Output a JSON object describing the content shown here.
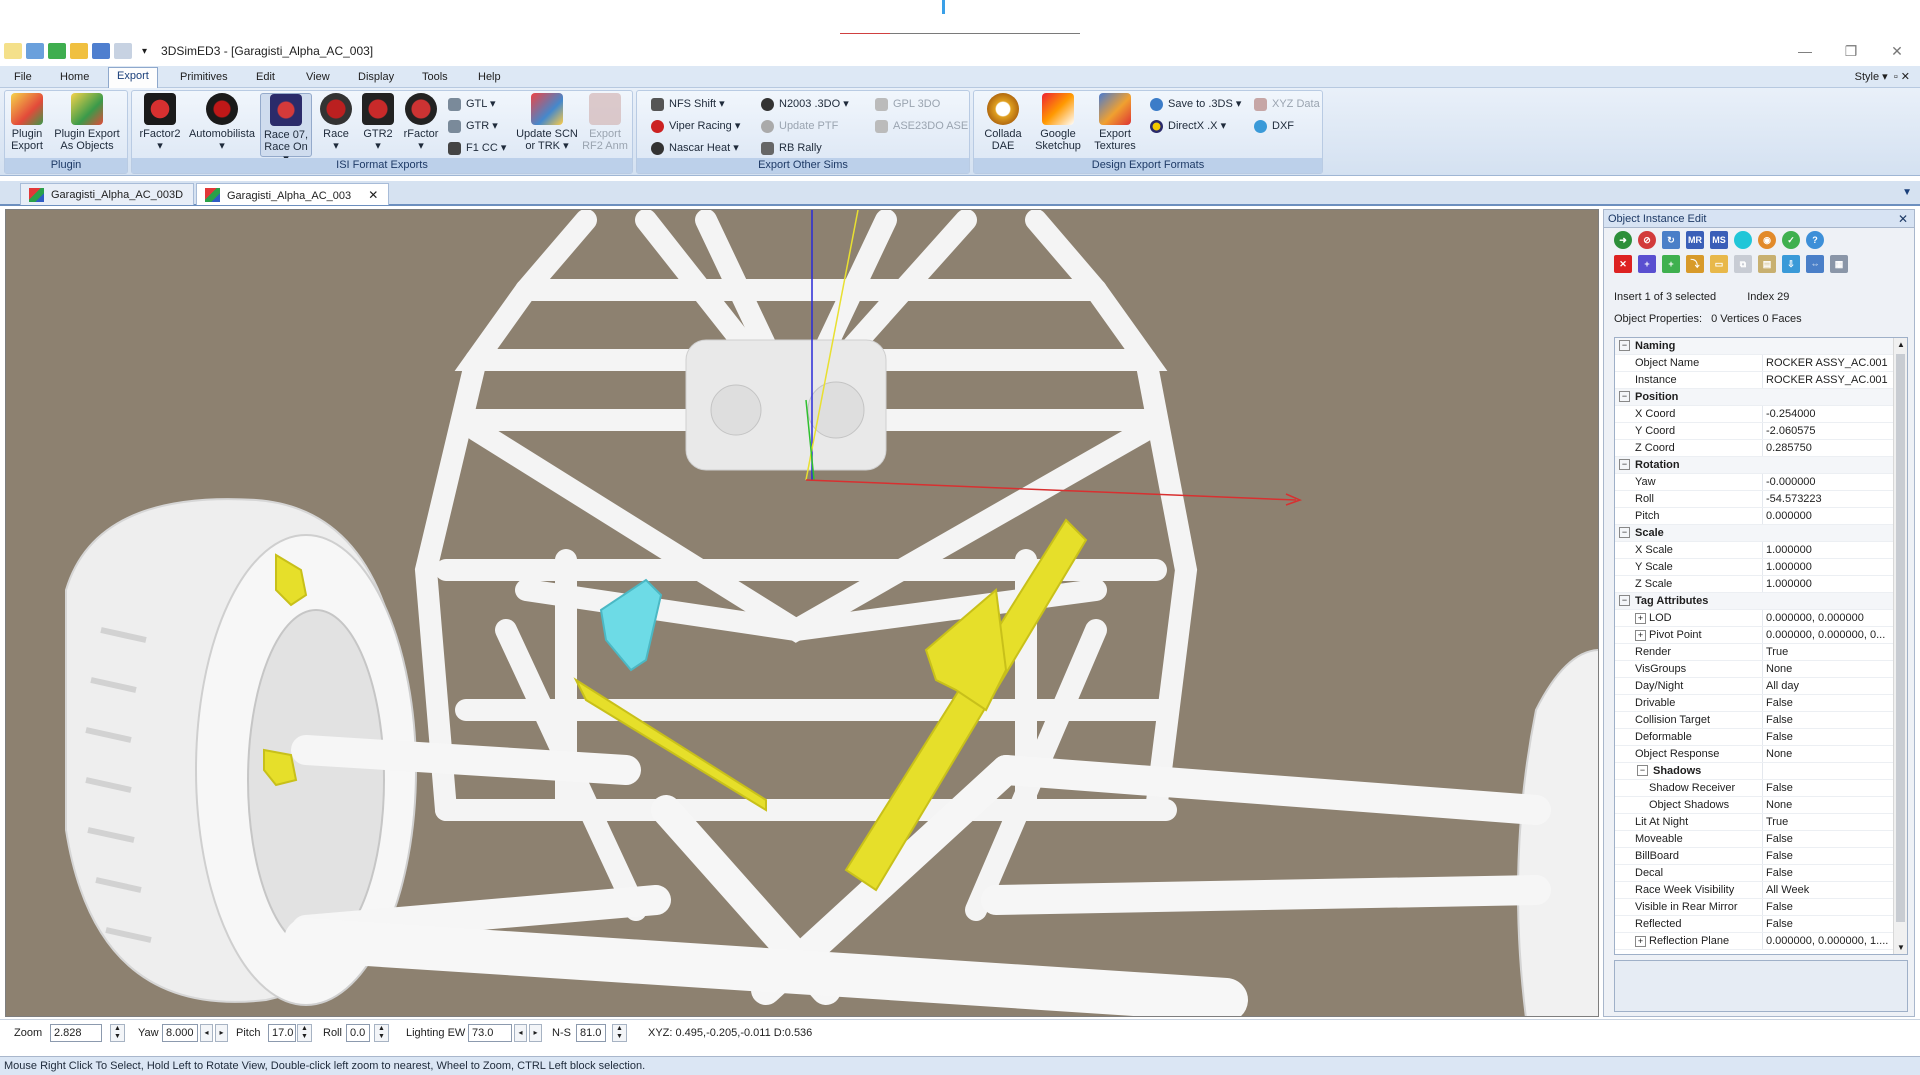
{
  "window": {
    "app_title": "3DSimED3 - [Garagisti_Alpha_AC_003]",
    "menu_arrow": "▾"
  },
  "menu": {
    "items": [
      "File",
      "Home",
      "Export",
      "Primitives",
      "Edit",
      "View",
      "Display",
      "Tools",
      "Help"
    ],
    "active": "Export",
    "style_label": "Style"
  },
  "ribbon": {
    "groups": {
      "plugin": "Plugin",
      "isi": "ISI Format Exports",
      "other": "Export Other Sims",
      "design": "Design Export Formats"
    },
    "plugin": {
      "plugin_export": [
        "Plugin",
        "Export"
      ],
      "plugin_export_objects": [
        "Plugin Export",
        "As Objects"
      ]
    },
    "isi": {
      "rfactor2": "rFactor2",
      "automobilista": "Automobilista",
      "race07": [
        "Race 07,",
        "Race On"
      ],
      "race": "Race",
      "gtr2": "GTR2",
      "rfactor": "rFactor",
      "gtl": "GTL",
      "gtr": "GTR",
      "f1cc": "F1 CC",
      "update_scn": [
        "Update SCN",
        "or TRK"
      ],
      "export_rf2_anm": [
        "Export",
        "RF2 Anm"
      ]
    },
    "other": {
      "nfs_shift": "NFS Shift",
      "viper_racing": "Viper Racing",
      "nascar_heat": "Nascar Heat",
      "n2003": "N2003 .3DO",
      "update_ptf": "Update PTF",
      "rb_rally": "RB Rally",
      "gpl_3do": "GPL 3DO",
      "ase23do": "ASE23DO ASE"
    },
    "design": {
      "collada": [
        "Collada",
        "DAE"
      ],
      "google_sketchup": [
        "Google",
        "Sketchup"
      ],
      "export_textures": [
        "Export",
        "Textures"
      ],
      "save_3ds": "Save to .3DS",
      "directx": "DirectX .X",
      "xyz_data": "XYZ Data",
      "dxf": "DXF"
    }
  },
  "tabs": [
    {
      "label": "Garagisti_Alpha_AC_003D",
      "active": false
    },
    {
      "label": "Garagisti_Alpha_AC_003",
      "active": true
    }
  ],
  "panel": {
    "title": "Object Instance Edit",
    "toolbar_text": {
      "mr": "MR",
      "ms": "MS"
    },
    "insert_info": "Insert 1 of 3 selected",
    "index_info": "Index 29",
    "object_props_label": "Object Properties:",
    "object_props_value": "0 Vertices 0 Faces",
    "rows": [
      {
        "kind": "cat",
        "name": "Naming"
      },
      {
        "kind": "prop",
        "name": "Object Name",
        "value": "ROCKER ASSY_AC.001"
      },
      {
        "kind": "prop",
        "name": "Instance",
        "value": "ROCKER ASSY_AC.001"
      },
      {
        "kind": "cat",
        "name": "Position"
      },
      {
        "kind": "prop",
        "name": "X Coord",
        "value": "-0.254000"
      },
      {
        "kind": "prop",
        "name": "Y Coord",
        "value": "-2.060575"
      },
      {
        "kind": "prop",
        "name": "Z Coord",
        "value": "0.285750"
      },
      {
        "kind": "cat",
        "name": "Rotation"
      },
      {
        "kind": "prop",
        "name": "Yaw",
        "value": "-0.000000"
      },
      {
        "kind": "prop",
        "name": "Roll",
        "value": "-54.573223"
      },
      {
        "kind": "prop",
        "name": "Pitch",
        "value": "0.000000"
      },
      {
        "kind": "cat",
        "name": "Scale"
      },
      {
        "kind": "prop",
        "name": "X Scale",
        "value": "1.000000"
      },
      {
        "kind": "prop",
        "name": "Y Scale",
        "value": "1.000000"
      },
      {
        "kind": "prop",
        "name": "Z Scale",
        "value": "1.000000"
      },
      {
        "kind": "cat",
        "name": "Tag Attributes"
      },
      {
        "kind": "expand",
        "name": "LOD",
        "value": "0.000000, 0.000000"
      },
      {
        "kind": "expand",
        "name": "Pivot Point",
        "value": "0.000000, 0.000000, 0..."
      },
      {
        "kind": "prop",
        "name": "Render",
        "value": "True"
      },
      {
        "kind": "prop",
        "name": "VisGroups",
        "value": "None"
      },
      {
        "kind": "prop",
        "name": "Day/Night",
        "value": "All day"
      },
      {
        "kind": "prop",
        "name": "Drivable",
        "value": "False"
      },
      {
        "kind": "prop",
        "name": "Collision Target",
        "value": "False"
      },
      {
        "kind": "prop",
        "name": "Deformable",
        "value": "False"
      },
      {
        "kind": "prop",
        "name": "Object Response",
        "value": "None"
      },
      {
        "kind": "subcat",
        "name": "Shadows"
      },
      {
        "kind": "sub",
        "name": "Shadow Receiver",
        "value": "False"
      },
      {
        "kind": "sub",
        "name": "Object Shadows",
        "value": "None"
      },
      {
        "kind": "prop",
        "name": "Lit At Night",
        "value": "True"
      },
      {
        "kind": "prop",
        "name": "Moveable",
        "value": "False"
      },
      {
        "kind": "prop",
        "name": "BillBoard",
        "value": "False"
      },
      {
        "kind": "prop",
        "name": "Decal",
        "value": "False"
      },
      {
        "kind": "prop",
        "name": "Race Week Visibility",
        "value": "All Week"
      },
      {
        "kind": "prop",
        "name": "Visible in Rear Mirror",
        "value": "False"
      },
      {
        "kind": "prop",
        "name": "Reflected",
        "value": "False"
      },
      {
        "kind": "expand",
        "name": "Reflection Plane",
        "value": "0.000000, 0.000000, 1...."
      }
    ]
  },
  "controls": {
    "zoom_label": "Zoom",
    "zoom_value": "2.828",
    "yaw_label": "Yaw",
    "yaw_value": "8.000",
    "pitch_label": "Pitch",
    "pitch_value": "17.0",
    "roll_label": "Roll",
    "roll_value": "0.0",
    "lighting_label": "Lighting EW",
    "lighting_value": "73.0",
    "ns_label": "N-S",
    "ns_value": "81.0",
    "xyz_readout": "XYZ: 0.495,-0.205,-0.011  D:0.536"
  },
  "status": {
    "text": "Mouse Right Click To Select, Hold Left to Rotate View, Double-click left  zoom to nearest, Wheel to Zoom, CTRL Left block selection."
  },
  "colors": {
    "viewport_bg": "#8d8170",
    "selection_yellow": "#e6df2a",
    "selection_cyan": "#6ddbe6",
    "frame_white": "#f4f4f4"
  }
}
